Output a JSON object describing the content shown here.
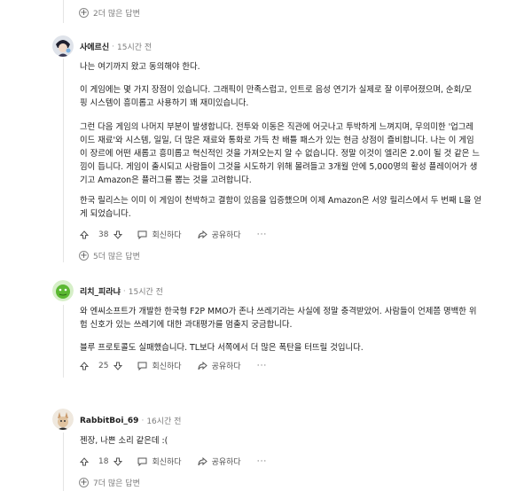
{
  "top_more": {
    "label": "2더 많은 답변"
  },
  "comments": [
    {
      "author": "사에르신",
      "time": "15시간 전",
      "paragraphs": [
        [
          "나는 여기까지 왔고 동의해야 한다."
        ],
        [
          "이 게임에는 몇 가지 장점이 있습니다. 그래픽이 만족스럽고, 인트로 음성 연기가 실제로 잘 이루어졌으며, 순회/모",
          "핑 시스템이 흥미롭고 사용하기 꽤 재미있습니다."
        ],
        [
          "그런 다음 게임의 나머지 부분이 발생합니다. 전투와 이동은 직관에 어긋나고 투박하게 느껴지며, 무의미한 '업그레",
          "이드 재료'와 시스템, 일일, 더 많은 재료와 통화로 가득 찬 배틀 패스가 있는 현금 상점이 즐비합니다. 나는 이 게임",
          "이 장르에 어떤 새롭고 흥미롭고 혁신적인 것을 가져오는지 알 수 없습니다. 정말 이것이 엘리온 2.0이 될 것 같은 느",
          "낌이 듭니다. 게임이 출시되고 사람들이 그것을 시도하기 위해 몰려들고 3개월 안에 5,000명의 활성 플레이어가 생",
          "기고 Amazon은 플러그를 뽑는 것을 고려합니다."
        ],
        [
          "한국 릴리스는 이미 이 게임이 천박하고 결함이 있음을 입증했으며 이제 Amazon은 서양 릴리스에서 두 번째 L을 얻",
          "게 되었습니다."
        ]
      ],
      "votes": "38",
      "reply": "회신하다",
      "share": "공유하다",
      "more": "5더 많은 답변"
    },
    {
      "author": "리치_피라냐",
      "time": "15시간 전",
      "paragraphs": [
        [
          "와 엔씨소프트가 개발한 한국형 F2P MMO가 존나 쓰레기라는 사실에 정말 충격받았어. 사람들이 언제쯤 명백한 위",
          "험 신호가 있는 쓰레기에 대한 과대평가를 멈출지 궁금합니다."
        ],
        [
          "블루 프로토콜도 실패했습니다. TL보다 서쪽에서 더 많은 폭탄을 터뜨릴 것입니다."
        ]
      ],
      "votes": "25",
      "reply": "회신하다",
      "share": "공유하다"
    },
    {
      "author": "RabbitBoi_69",
      "time": "16시간 전",
      "paragraphs": [
        [
          "젠장, 나쁜 소리 같은데 :("
        ]
      ],
      "votes": "18",
      "reply": "회신하다",
      "share": "공유하다",
      "more": "7더 많은 답변"
    }
  ],
  "colors": {
    "text": "#1c1c1c",
    "muted": "#7c7c7c",
    "line": "#e5e5e5"
  },
  "icons": [
    "plus-circle-icon",
    "upvote-arrow-icon",
    "downvote-arrow-icon",
    "comment-bubble-icon",
    "share-arrow-icon"
  ]
}
